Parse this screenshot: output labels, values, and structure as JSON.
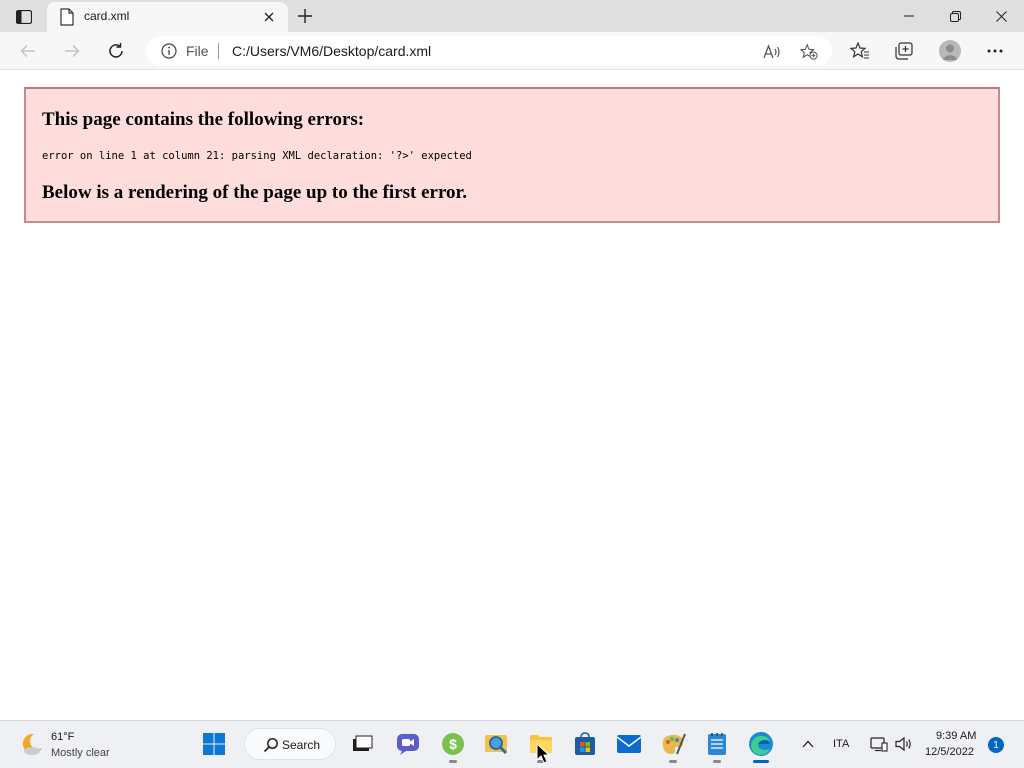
{
  "browser": {
    "tab": {
      "title": "card.xml"
    },
    "address": {
      "scheme": "File",
      "url": "C:/Users/VM6/Desktop/card.xml"
    }
  },
  "page": {
    "error_heading": "This page contains the following errors:",
    "error_message": "error on line 1 at column 21: parsing XML declaration: '?>' expected",
    "render_heading": "Below is a rendering of the page up to the first error."
  },
  "taskbar": {
    "weather": {
      "temp": "61°F",
      "desc": "Mostly clear"
    },
    "search_label": "Search",
    "apps": [
      "start-icon",
      "search",
      "task-view-icon",
      "chat-icon",
      "money-app-icon",
      "magnifier-app-icon",
      "file-explorer-icon",
      "store-icon",
      "mail-icon",
      "paint-app-icon",
      "notepad-icon",
      "edge-icon"
    ],
    "tray": {
      "language": "ITA",
      "time": "9:39 AM",
      "date": "12/5/2022",
      "notifications": "1"
    }
  },
  "colors": {
    "error_bg": "#ffdddd",
    "error_border": "#c88a8a",
    "accent": "#0067c0"
  }
}
